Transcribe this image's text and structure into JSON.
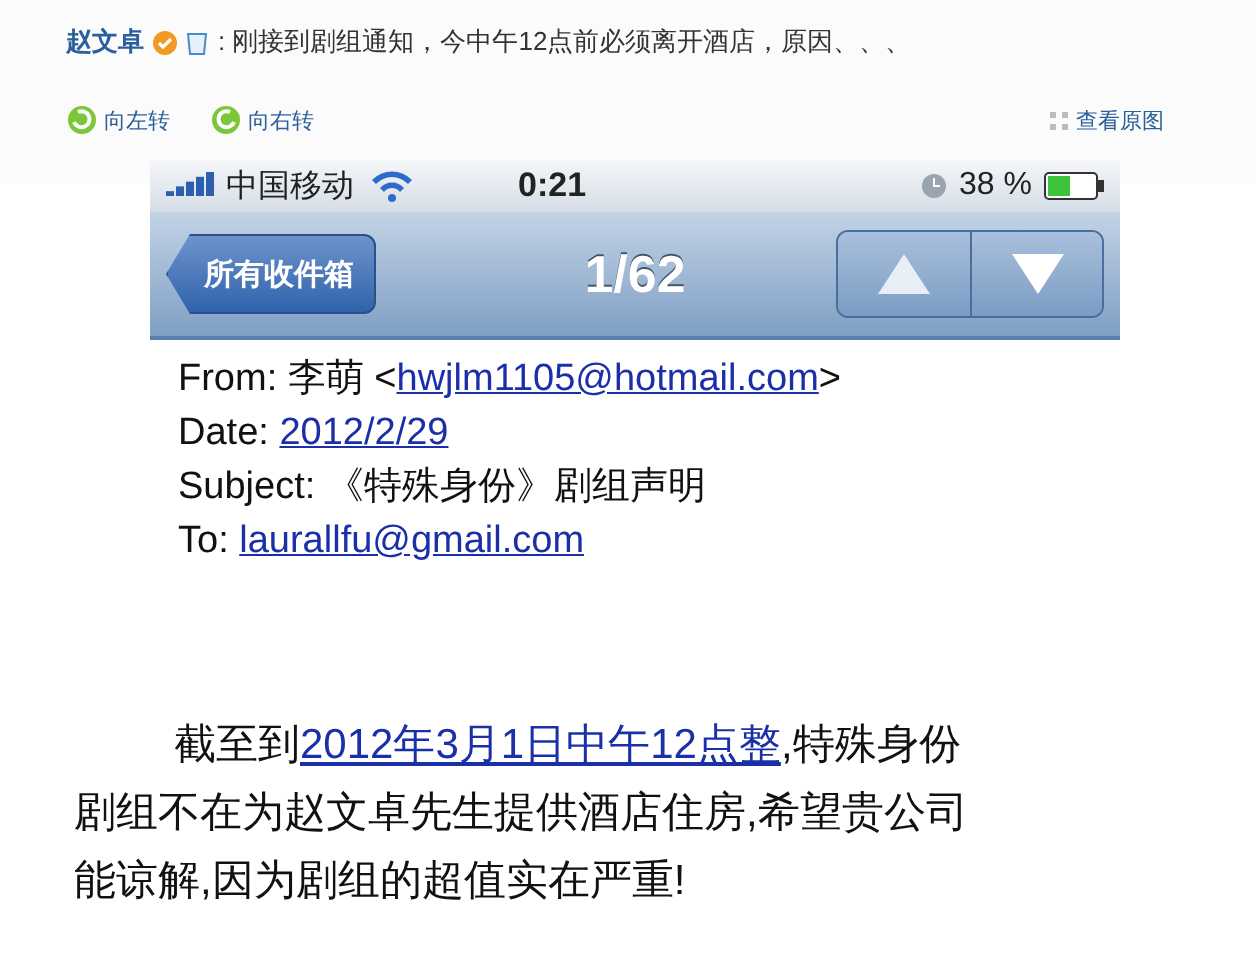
{
  "post": {
    "author": "赵文卓",
    "text": ": 刚接到剧组通知，今中午12点前必须离开酒店，原因、、、"
  },
  "image_actions": [
    {
      "label": "向左转"
    },
    {
      "label": "向右转"
    }
  ],
  "view_original": "查看原图",
  "status_bar": {
    "carrier": "中国移动",
    "time": "0:21",
    "battery": "38 %"
  },
  "nav": {
    "back": "所有收件箱",
    "counter": "1/62"
  },
  "headers": [
    {
      "segments": [
        {
          "kind": "text",
          "text": "From: 李萌 <"
        },
        {
          "kind": "link",
          "text": "hwjlm1105@hotmail.com"
        },
        {
          "kind": "text",
          "text": ">"
        }
      ]
    },
    {
      "segments": [
        {
          "kind": "text",
          "text": "Date: "
        },
        {
          "kind": "link",
          "text": "2012/2/29"
        }
      ]
    },
    {
      "segments": [
        {
          "kind": "text",
          "text": "Subject: 《特殊身份》剧组声明"
        }
      ]
    },
    {
      "segments": [
        {
          "kind": "text",
          "text": "To: "
        },
        {
          "kind": "link",
          "text": "laurallfu@gmail.com"
        }
      ]
    }
  ],
  "body": {
    "before": "截至到",
    "link": "2012年3月1日中午12点整",
    "after": ",特殊身份剧组不在为赵文卓先生提供酒店住房,希望贵公司能谅解,因为剧组的超值实在严重!"
  }
}
